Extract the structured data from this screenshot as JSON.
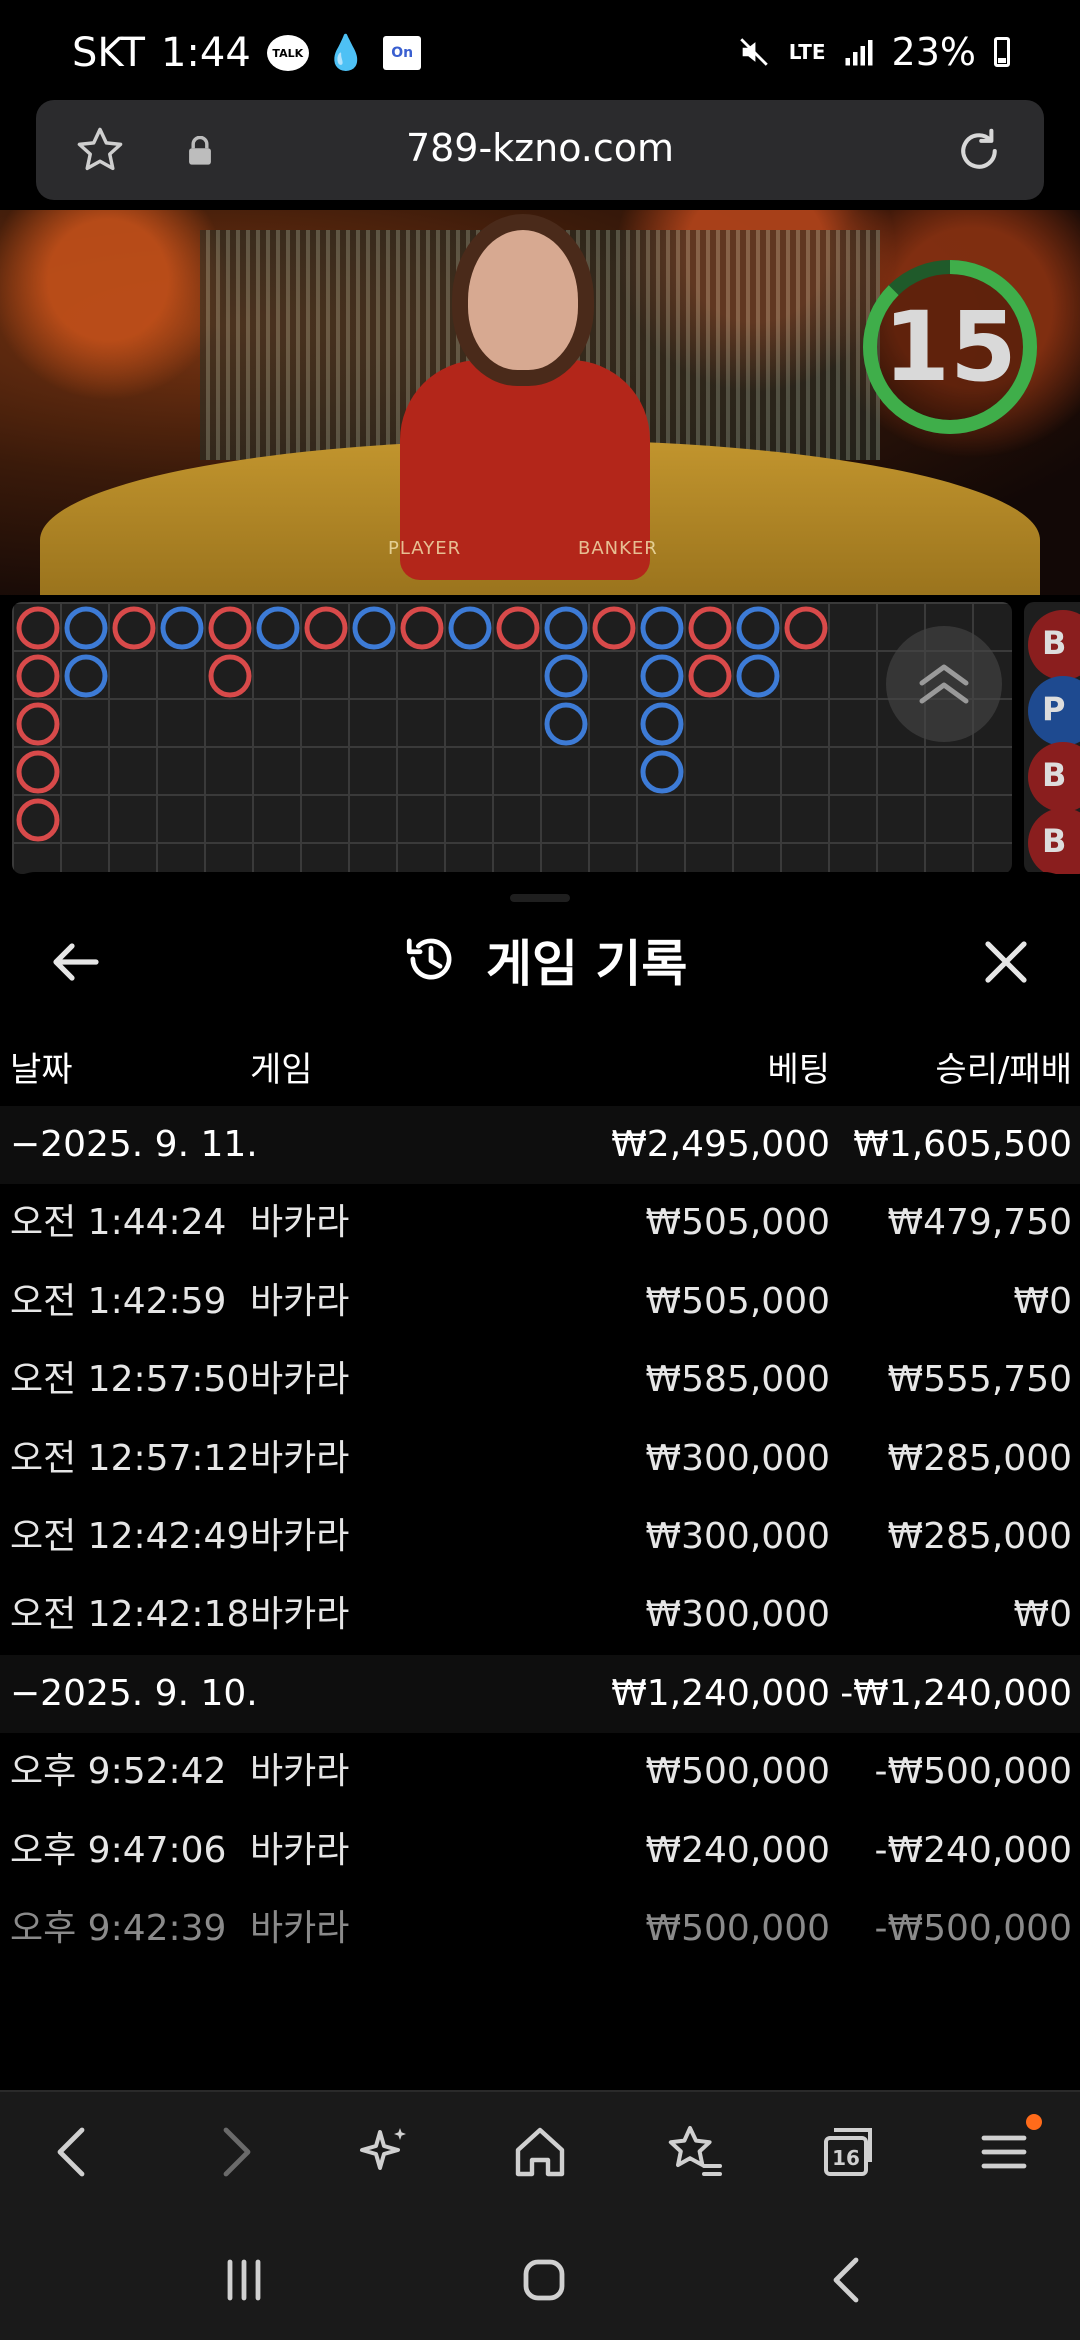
{
  "status_bar": {
    "carrier": "SKT",
    "time": "1:44",
    "talk_badge": "TALK",
    "on_badge": "On",
    "network": "LTE",
    "battery": "23%"
  },
  "browser": {
    "url": "789-kzno.com"
  },
  "game": {
    "countdown": "15",
    "table_labels": [
      "PLAYER",
      "BANKER"
    ]
  },
  "bead_road": {
    "colors": {
      "banker": "#d84a4a",
      "player": "#3d7bd6",
      "tie": "#3fa35a"
    },
    "columns": [
      [
        "B",
        "B",
        "B",
        "B",
        "B"
      ],
      [
        "P",
        "P"
      ],
      [
        "B"
      ],
      [
        "P"
      ],
      [
        "B",
        "B"
      ],
      [
        "P"
      ],
      [
        "B"
      ],
      [
        "P"
      ],
      [
        "B"
      ],
      [
        "P"
      ],
      [
        "B"
      ],
      [
        "P",
        "P",
        "P"
      ],
      [
        "B"
      ],
      [
        "P",
        "P",
        "P",
        "P"
      ],
      [
        "B",
        "B"
      ],
      [
        "P",
        "P"
      ],
      [
        "B"
      ]
    ],
    "side_labels": [
      "B",
      "P",
      "B",
      "B"
    ]
  },
  "history": {
    "title": "게임 기록",
    "headers": {
      "date": "날짜",
      "game": "게임",
      "bet": "베팅",
      "result": "승리/패배"
    },
    "rows": [
      {
        "type": "summary",
        "date": "−2025. 9. 11.",
        "game": "",
        "bet": "₩2,495,000",
        "result": "₩1,605,500"
      },
      {
        "type": "item",
        "date": "오전 1:44:24",
        "game": "바카라",
        "bet": "₩505,000",
        "result": "₩479,750"
      },
      {
        "type": "item",
        "date": "오전 1:42:59",
        "game": "바카라",
        "bet": "₩505,000",
        "result": "₩0"
      },
      {
        "type": "item",
        "date": "오전 12:57:50",
        "game": "바카라",
        "bet": "₩585,000",
        "result": "₩555,750"
      },
      {
        "type": "item",
        "date": "오전 12:57:12",
        "game": "바카라",
        "bet": "₩300,000",
        "result": "₩285,000"
      },
      {
        "type": "item",
        "date": "오전 12:42:49",
        "game": "바카라",
        "bet": "₩300,000",
        "result": "₩285,000"
      },
      {
        "type": "item",
        "date": "오전 12:42:18",
        "game": "바카라",
        "bet": "₩300,000",
        "result": "₩0"
      },
      {
        "type": "summary",
        "date": "−2025. 9. 10.",
        "game": "",
        "bet": "₩1,240,000",
        "result": "-₩1,240,000"
      },
      {
        "type": "item",
        "date": "오후 9:52:42",
        "game": "바카라",
        "bet": "₩500,000",
        "result": "-₩500,000"
      },
      {
        "type": "item",
        "date": "오후 9:47:06",
        "game": "바카라",
        "bet": "₩240,000",
        "result": "-₩240,000"
      },
      {
        "type": "item faded",
        "date": "오후 9:42:39",
        "game": "바카라",
        "bet": "₩500,000",
        "result": "-₩500,000"
      }
    ]
  },
  "browser_nav": {
    "tab_count": "16",
    "icons": [
      "back-icon",
      "forward-icon",
      "ai-sparkle-icon",
      "home-icon",
      "bookmarks-icon",
      "tabs-icon",
      "menu-icon"
    ]
  },
  "system_nav": {
    "icons": [
      "recents-icon",
      "home-icon",
      "back-icon"
    ]
  }
}
